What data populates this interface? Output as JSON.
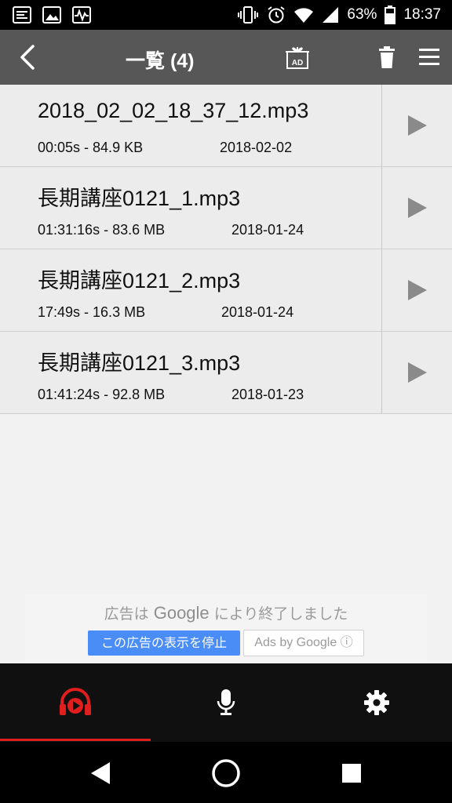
{
  "status_bar": {
    "battery_percent": "63%",
    "time": "18:37"
  },
  "app_bar": {
    "title": "一覧 (4)",
    "ad_icon_label": "AD"
  },
  "files": [
    {
      "name": "2018_02_02_18_37_12.mp3",
      "meta": "00:05s - 84.9 KB",
      "date": "2018-02-02"
    },
    {
      "name": "長期講座0121_1.mp3",
      "meta": "01:31:16s - 83.6 MB",
      "date": "2018-01-24"
    },
    {
      "name": "長期講座0121_2.mp3",
      "meta": "17:49s - 16.3 MB",
      "date": "2018-01-24"
    },
    {
      "name": "長期講座0121_3.mp3",
      "meta": "01:41:24s - 92.8 MB",
      "date": "2018-01-23"
    }
  ],
  "ad": {
    "prefix": "広告は",
    "brand": "Google",
    "suffix": "により終了しました",
    "stop_button": "この広告の表示を停止",
    "ads_by": "Ads by Google ⓘ"
  },
  "tabs": [
    {
      "name": "player",
      "icon": "headphones-play-icon",
      "active": true
    },
    {
      "name": "recorder",
      "icon": "microphone-icon",
      "active": false
    },
    {
      "name": "settings",
      "icon": "gear-icon",
      "active": false
    }
  ],
  "colors": {
    "app_bar": "#575757",
    "active_tab": "#e01e1e",
    "ad_button": "#4a8df6",
    "list_bg": "#ececec"
  }
}
